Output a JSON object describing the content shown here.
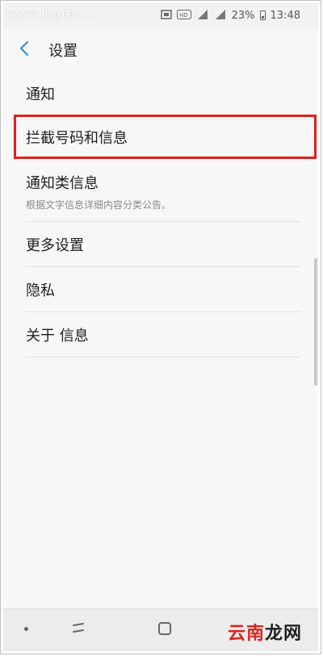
{
  "status_bar": {
    "watermark": "www.kgtai...",
    "battery": "23%",
    "time": "13:48",
    "icons": [
      "sim-icon",
      "hd-icon",
      "signal-4g-icon",
      "signal-4g-icon",
      "battery-icon"
    ]
  },
  "header": {
    "title": "设置",
    "back_icon": "chevron-left-icon",
    "accent_color": "#3a8fd1"
  },
  "settings": {
    "items": [
      {
        "title": "通知"
      },
      {
        "title": "拦截号码和信息",
        "highlighted": true
      },
      {
        "title": "通知类信息",
        "subtitle": "根据文字信息详细内容分类公告。"
      },
      {
        "title": "更多设置"
      },
      {
        "title": "隐私"
      },
      {
        "title": "关于 信息"
      }
    ]
  },
  "highlight_color": "#e0211d",
  "nav_bar": {
    "icons": [
      "menu-dot-icon",
      "recent-apps-icon",
      "home-icon"
    ]
  },
  "watermark": {
    "red_text": "云南",
    "dark_text": "龙网"
  }
}
